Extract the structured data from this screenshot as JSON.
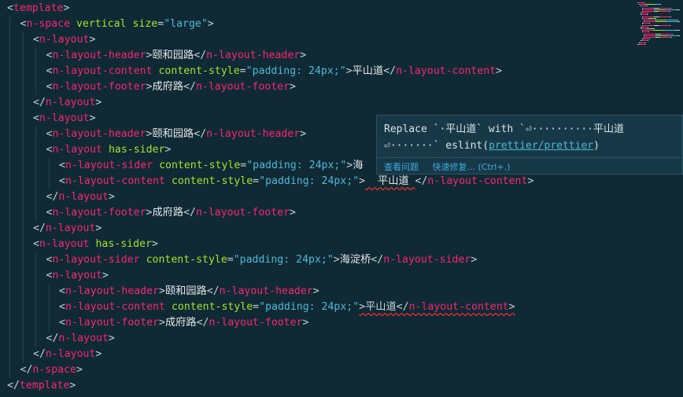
{
  "editor": {
    "lines": [
      {
        "indent": 0,
        "tokens": [
          [
            "b",
            "<"
          ],
          [
            "tag",
            "template"
          ],
          [
            "b",
            ">"
          ]
        ]
      },
      {
        "indent": 1,
        "tokens": [
          [
            "b",
            "<"
          ],
          [
            "tag",
            "n-space"
          ],
          [
            "b",
            " "
          ],
          [
            "attr",
            "vertical"
          ],
          [
            "b",
            " "
          ],
          [
            "attr",
            "size"
          ],
          [
            "b",
            "="
          ],
          [
            "str",
            "\"large\""
          ],
          [
            "b",
            ">"
          ]
        ]
      },
      {
        "indent": 2,
        "tokens": [
          [
            "b",
            "<"
          ],
          [
            "tag",
            "n-layout"
          ],
          [
            "b",
            ">"
          ]
        ]
      },
      {
        "indent": 3,
        "tokens": [
          [
            "b",
            "<"
          ],
          [
            "tag",
            "n-layout-header"
          ],
          [
            "b",
            ">"
          ],
          [
            "txt",
            "颐和园路"
          ],
          [
            "b",
            "</"
          ],
          [
            "tag",
            "n-layout-header"
          ],
          [
            "b",
            ">"
          ]
        ]
      },
      {
        "indent": 3,
        "tokens": [
          [
            "b",
            "<"
          ],
          [
            "tag",
            "n-layout-content"
          ],
          [
            "b",
            " "
          ],
          [
            "attr",
            "content-style"
          ],
          [
            "b",
            "="
          ],
          [
            "str",
            "\"padding: 24px;\""
          ],
          [
            "b",
            ">"
          ],
          [
            "txt",
            "平山道"
          ],
          [
            "b",
            "</"
          ],
          [
            "tag",
            "n-layout-content"
          ],
          [
            "b",
            ">"
          ]
        ]
      },
      {
        "indent": 3,
        "tokens": [
          [
            "b",
            "<"
          ],
          [
            "tag",
            "n-layout-footer"
          ],
          [
            "b",
            ">"
          ],
          [
            "txt",
            "成府路"
          ],
          [
            "b",
            "</"
          ],
          [
            "tag",
            "n-layout-footer"
          ],
          [
            "b",
            ">"
          ]
        ]
      },
      {
        "indent": 2,
        "tokens": [
          [
            "b",
            "</"
          ],
          [
            "tag",
            "n-layout"
          ],
          [
            "b",
            ">"
          ]
        ]
      },
      {
        "indent": 2,
        "tokens": [
          [
            "b",
            "<"
          ],
          [
            "tag",
            "n-layout"
          ],
          [
            "b",
            ">"
          ]
        ]
      },
      {
        "indent": 3,
        "tokens": [
          [
            "b",
            "<"
          ],
          [
            "tag",
            "n-layout-header"
          ],
          [
            "b",
            ">"
          ],
          [
            "txt",
            "颐和园路"
          ],
          [
            "b",
            "</"
          ],
          [
            "tag",
            "n-layout-header"
          ],
          [
            "b",
            ">"
          ]
        ]
      },
      {
        "indent": 3,
        "tokens": [
          [
            "b",
            "<"
          ],
          [
            "tag",
            "n-layout"
          ],
          [
            "b",
            " "
          ],
          [
            "attr",
            "has-sider"
          ],
          [
            "b",
            ">"
          ]
        ]
      },
      {
        "indent": 4,
        "tokens": [
          [
            "b",
            "<"
          ],
          [
            "tag",
            "n-layout-sider"
          ],
          [
            "b",
            " "
          ],
          [
            "attr",
            "content-style"
          ],
          [
            "b",
            "="
          ],
          [
            "str",
            "\"padding: 24px;\""
          ],
          [
            "b",
            ">"
          ],
          [
            "txt",
            "海"
          ]
        ]
      },
      {
        "indent": 4,
        "tokens": [
          [
            "b",
            "<"
          ],
          [
            "tag",
            "n-layout-content"
          ],
          [
            "b",
            " "
          ],
          [
            "attr",
            "content-style"
          ],
          [
            "b",
            "="
          ],
          [
            "str",
            "\"padding: 24px;\""
          ],
          [
            "b",
            ">"
          ],
          [
            "sq",
            "  平山道 "
          ],
          [
            "b",
            "</"
          ],
          [
            "tag",
            "n-layout-content"
          ],
          [
            "b",
            ">"
          ]
        ]
      },
      {
        "indent": 3,
        "tokens": [
          [
            "b",
            "</"
          ],
          [
            "tag",
            "n-layout"
          ],
          [
            "b",
            ">"
          ]
        ]
      },
      {
        "indent": 3,
        "tokens": [
          [
            "b",
            "<"
          ],
          [
            "tag",
            "n-layout-footer"
          ],
          [
            "b",
            ">"
          ],
          [
            "txt",
            "成府路"
          ],
          [
            "b",
            "</"
          ],
          [
            "tag",
            "n-layout-footer"
          ],
          [
            "b",
            ">"
          ]
        ]
      },
      {
        "indent": 2,
        "tokens": [
          [
            "b",
            "</"
          ],
          [
            "tag",
            "n-layout"
          ],
          [
            "b",
            ">"
          ]
        ]
      },
      {
        "indent": 2,
        "tokens": [
          [
            "b",
            "<"
          ],
          [
            "tag",
            "n-layout"
          ],
          [
            "b",
            " "
          ],
          [
            "attr",
            "has-sider"
          ],
          [
            "b",
            ">"
          ]
        ]
      },
      {
        "indent": 3,
        "tokens": [
          [
            "b",
            "<"
          ],
          [
            "tag",
            "n-layout-sider"
          ],
          [
            "b",
            " "
          ],
          [
            "attr",
            "content-style"
          ],
          [
            "b",
            "="
          ],
          [
            "str",
            "\"padding: 24px;\""
          ],
          [
            "b",
            ">"
          ],
          [
            "txt",
            "海淀桥"
          ],
          [
            "b",
            "</"
          ],
          [
            "tag",
            "n-layout-sider"
          ],
          [
            "b",
            ">"
          ]
        ]
      },
      {
        "indent": 3,
        "tokens": [
          [
            "b",
            "<"
          ],
          [
            "tag",
            "n-layout"
          ],
          [
            "b",
            ">"
          ]
        ]
      },
      {
        "indent": 4,
        "tokens": [
          [
            "b",
            "<"
          ],
          [
            "tag",
            "n-layout-header"
          ],
          [
            "b",
            ">"
          ],
          [
            "txt",
            "颐和园路"
          ],
          [
            "b",
            "</"
          ],
          [
            "tag",
            "n-layout-header"
          ],
          [
            "b",
            ">"
          ]
        ]
      },
      {
        "indent": 4,
        "tokens": [
          [
            "b",
            "<"
          ],
          [
            "tag",
            "n-layout-content"
          ],
          [
            "b",
            " "
          ],
          [
            "attr",
            "content-style"
          ],
          [
            "b",
            "="
          ],
          [
            "str",
            "\"padding: 24px;\""
          ],
          [
            "sqb",
            ">平山道</"
          ],
          [
            "sqt",
            "n-layout-content"
          ],
          [
            "sqb",
            ">"
          ]
        ]
      },
      {
        "indent": 4,
        "tokens": [
          [
            "b",
            "<"
          ],
          [
            "tag",
            "n-layout-footer"
          ],
          [
            "b",
            ">"
          ],
          [
            "txt",
            "成府路"
          ],
          [
            "b",
            "</"
          ],
          [
            "tag",
            "n-layout-footer"
          ],
          [
            "b",
            ">"
          ]
        ]
      },
      {
        "indent": 3,
        "tokens": [
          [
            "b",
            "</"
          ],
          [
            "tag",
            "n-layout"
          ],
          [
            "b",
            ">"
          ]
        ]
      },
      {
        "indent": 2,
        "tokens": [
          [
            "b",
            "</"
          ],
          [
            "tag",
            "n-layout"
          ],
          [
            "b",
            ">"
          ]
        ]
      },
      {
        "indent": 1,
        "tokens": [
          [
            "b",
            "</"
          ],
          [
            "tag",
            "n-space"
          ],
          [
            "b",
            ">"
          ]
        ]
      },
      {
        "indent": 0,
        "tokens": [
          [
            "b",
            "</"
          ],
          [
            "tag",
            "template"
          ],
          [
            "b",
            ">"
          ]
        ]
      }
    ]
  },
  "hover": {
    "message_prefix": "Replace `·平山道` with `⏎··········平山道",
    "message_line2": "⏎·······` eslint(",
    "rule_link": "prettier/prettier",
    "message_suffix": ")",
    "action_view": "查看问题",
    "action_fix": "快速修复... (Ctrl+.)"
  },
  "colors": {
    "background": "#0f2a35",
    "tag": "#f92672",
    "attribute": "#a6e22e",
    "string": "#4fb8d6",
    "link": "#3da9e0"
  }
}
